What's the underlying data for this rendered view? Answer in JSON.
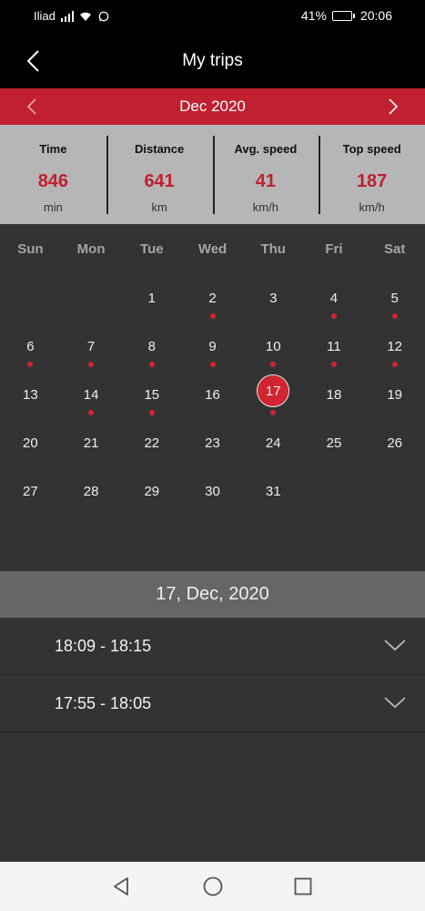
{
  "status_bar": {
    "carrier": "Iliad",
    "battery": "41%",
    "battery_level": 0.41,
    "time": "20:06"
  },
  "header": {
    "title": "My trips",
    "back_icon": "chevron-left-icon"
  },
  "month_bar": {
    "label": "Dec 2020",
    "prev_icon": "chevron-left-icon",
    "next_icon": "chevron-right-icon",
    "color": "#c0202f"
  },
  "stats": [
    {
      "name": "Time",
      "value": "846",
      "unit": "min"
    },
    {
      "name": "Distance",
      "value": "641",
      "unit": "km"
    },
    {
      "name": "Avg. speed",
      "value": "41",
      "unit": "km/h"
    },
    {
      "name": "Top speed",
      "value": "187",
      "unit": "km/h"
    }
  ],
  "calendar": {
    "weekdays": [
      "Sun",
      "Mon",
      "Tue",
      "Wed",
      "Thu",
      "Fri",
      "Sat"
    ],
    "weeks": [
      [
        {
          "day": ""
        },
        {
          "day": ""
        },
        {
          "day": "1",
          "trip": false
        },
        {
          "day": "2",
          "trip": true
        },
        {
          "day": "3",
          "trip": false
        },
        {
          "day": "4",
          "trip": true
        },
        {
          "day": "5",
          "trip": true
        }
      ],
      [
        {
          "day": "6",
          "trip": true
        },
        {
          "day": "7",
          "trip": true
        },
        {
          "day": "8",
          "trip": true
        },
        {
          "day": "9",
          "trip": true
        },
        {
          "day": "10",
          "trip": true
        },
        {
          "day": "11",
          "trip": true
        },
        {
          "day": "12",
          "trip": true
        }
      ],
      [
        {
          "day": "13",
          "trip": false
        },
        {
          "day": "14",
          "trip": true
        },
        {
          "day": "15",
          "trip": true
        },
        {
          "day": "16",
          "trip": false
        },
        {
          "day": "17",
          "trip": true,
          "selected": true
        },
        {
          "day": "18",
          "trip": false
        },
        {
          "day": "19",
          "trip": false
        }
      ],
      [
        {
          "day": "20",
          "trip": false
        },
        {
          "day": "21",
          "trip": false
        },
        {
          "day": "22",
          "trip": false
        },
        {
          "day": "23",
          "trip": false
        },
        {
          "day": "24",
          "trip": false
        },
        {
          "day": "25",
          "trip": false
        },
        {
          "day": "26",
          "trip": false
        }
      ],
      [
        {
          "day": "27",
          "trip": false
        },
        {
          "day": "28",
          "trip": false
        },
        {
          "day": "29",
          "trip": false
        },
        {
          "day": "30",
          "trip": false
        },
        {
          "day": "31",
          "trip": false
        },
        {
          "day": ""
        },
        {
          "day": ""
        }
      ]
    ]
  },
  "selected_date": "17, Dec, 2020",
  "trips": [
    {
      "time": "18:09 - 18:15",
      "icon": "chevron-down-icon"
    },
    {
      "time": "17:55 - 18:05",
      "icon": "chevron-down-icon"
    }
  ],
  "nav_bar": {
    "back": "triangle-back-icon",
    "home": "circle-home-icon",
    "recents": "square-recents-icon"
  }
}
